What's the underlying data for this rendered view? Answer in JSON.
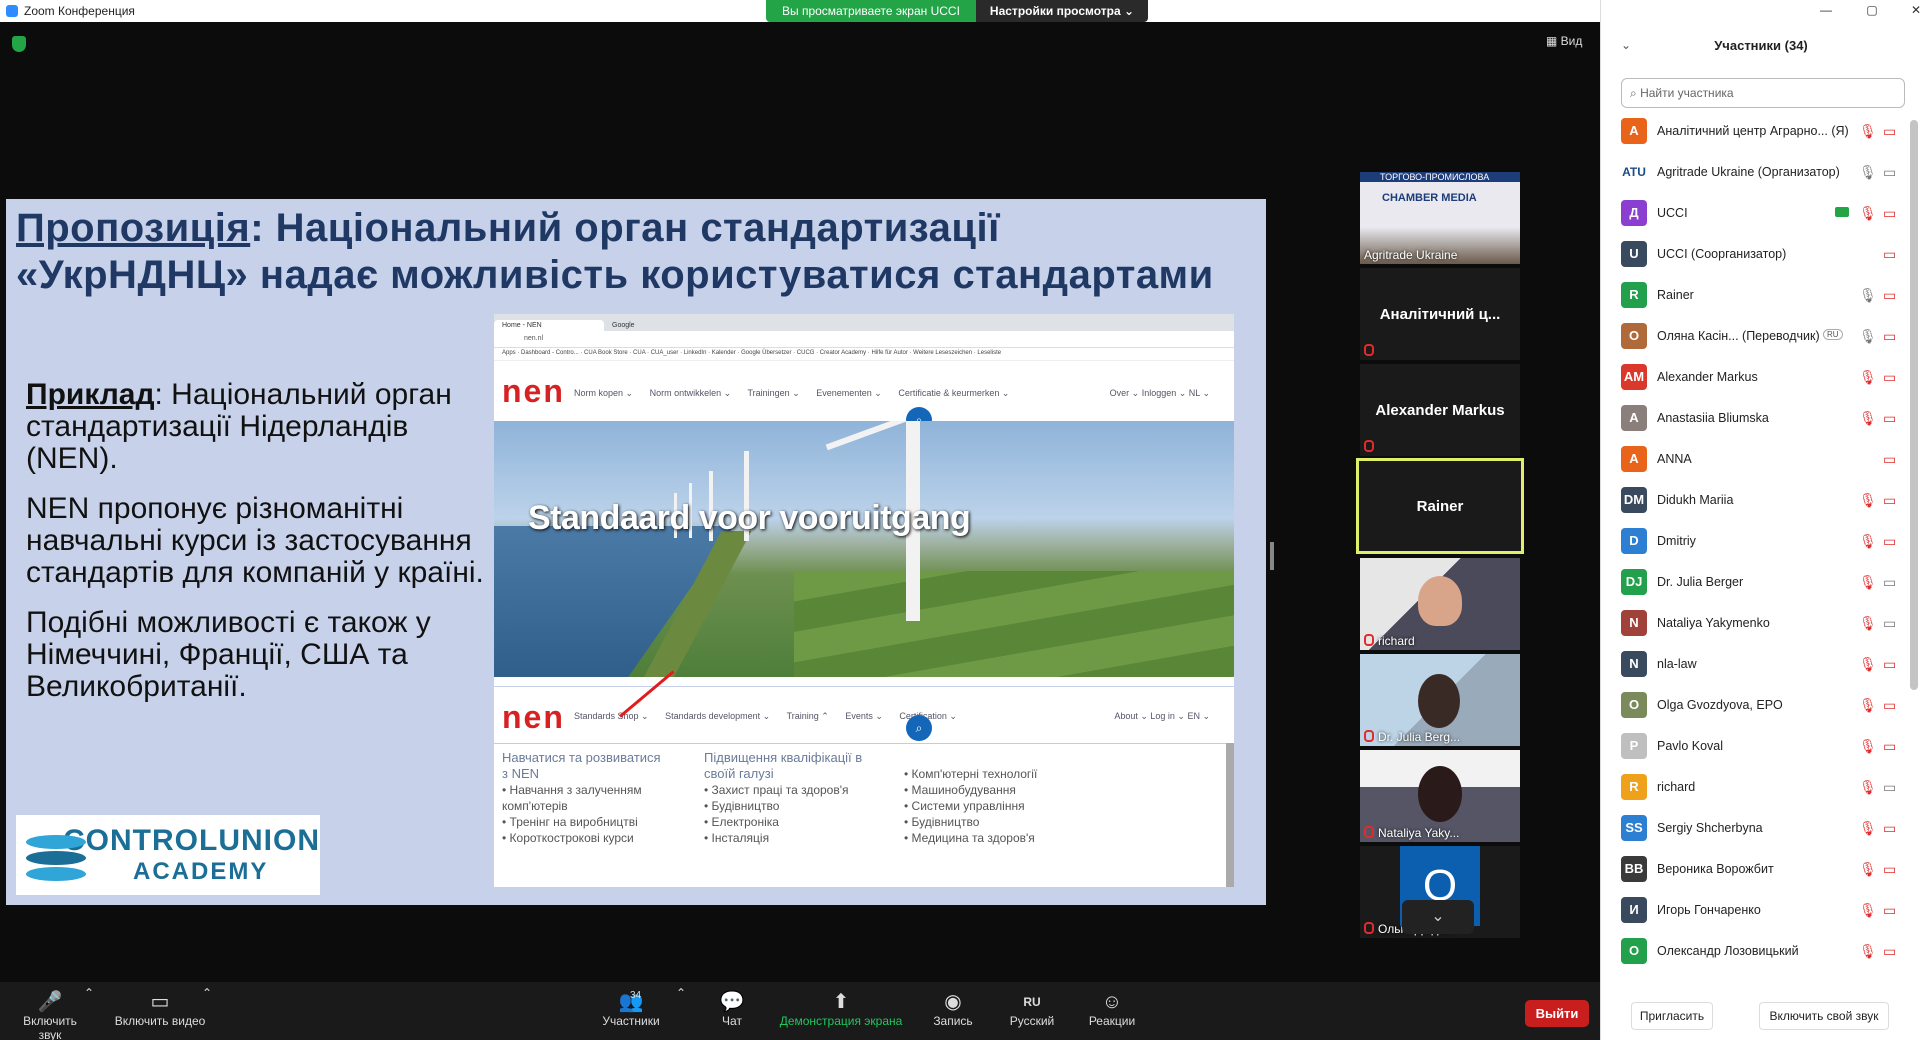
{
  "window": {
    "title": "Zoom Конференция"
  },
  "banner": {
    "viewing": "Вы просматриваете экран UCCI",
    "view_settings": "Настройки просмотра ⌄"
  },
  "view_button": "Вид",
  "slide": {
    "title_underlined": "Пропозиція",
    "title_rest": ":  Національний орган стандартизації «УкрНДНЦ» надає можливість користуватися стандартами",
    "example_label": "Приклад",
    "paragraph1": ": Національний орган стандартизації Нідерландів (NEN).",
    "paragraph2": "NEN пропонує різноманітні навчальні курси із застосування стандартів для компаній у країні.",
    "paragraph3": "Подібні можливості є також у Німеччині, Франції, США та Великобританії.",
    "logo_line1": "CONTROLUNION",
    "logo_line2": "ACADEMY",
    "browser": {
      "tab1": "Home - NEN",
      "tab2": "Google",
      "url": "nen.nl",
      "bookmarks": "Apps · Dashboard - Contro... · CUA Book Store · CUA · CUA_user · LinkedIn · Kalender · Google Übersetzer · CUCG · Creator Academy · Hilfe für Autor · Weitere Leseszeichen · Leseliste",
      "nen_logo": "nen",
      "menu": [
        "Norm kopen ⌄",
        "Norm ontwikkelen ⌄",
        "Trainingen ⌄",
        "Evenementen ⌄",
        "Certificatie & keurmerken ⌄"
      ],
      "menu_right": "Over ⌄   Inloggen ⌄   NL ⌄",
      "hero_text": "Standaard voor vooruitgang",
      "menu2": [
        "Standards Shop ⌄",
        "Standards development ⌄",
        "Training ⌃",
        "Events ⌄",
        "Certification ⌄"
      ],
      "menu2_right": "About ⌄   Log in ⌄   EN ⌄",
      "dropdown": {
        "col1_head": "Навчатися та розвиватися з NEN",
        "col1": [
          "• Навчання з залученням комп'ютерів",
          "• Тренінг на виробництві",
          "• Короткострокові курси"
        ],
        "col2_head": "Підвищення кваліфікації в своїй галузі",
        "col2": [
          "• Захист праці та здоров'я",
          "• Будівництво",
          "• Електроніка",
          "• Інсталяція"
        ],
        "col3": [
          "• Комп'ютерні технології",
          "• Машинобудування",
          "• Системи управління",
          "• Будівництво",
          "• Медицина та здоров'я"
        ]
      }
    }
  },
  "gallery": [
    {
      "name": "Agritrade Ukraine",
      "type": "video",
      "banner": "ТОРГОВО-ПРОМИСЛОВА",
      "banner2": "CHAMBER MEDIA"
    },
    {
      "name": "Аналітичний ц...",
      "type": "name"
    },
    {
      "name": "Alexander Markus",
      "type": "name"
    },
    {
      "name": "Rainer",
      "type": "name",
      "active": true
    },
    {
      "name": "richard",
      "type": "video"
    },
    {
      "name": "Dr. Julia Berg...",
      "type": "video"
    },
    {
      "name": "Nataliya Yaky...",
      "type": "video"
    },
    {
      "name": "Ольга Дюдя...",
      "type": "initial",
      "initial": "O"
    }
  ],
  "toolbar": {
    "unmute": "Включить звук",
    "start_video": "Включить видео",
    "participants": "Участники",
    "participants_count": "34",
    "chat": "Чат",
    "share": "Демонстрация экрана",
    "record": "Запись",
    "language": "Русский",
    "language_badge": "RU",
    "reactions": "Реакции",
    "leave": "Выйти"
  },
  "panel": {
    "title": "Участники (34)",
    "search_placeholder": "Найти участника",
    "invite": "Пригласить",
    "unmute_me": "Включить свой звук",
    "participants": [
      {
        "name": "Аналітичний центр Аграрно... (Я)",
        "initial": "А",
        "color": "#e8641b",
        "mic": "muted",
        "cam": "off"
      },
      {
        "name": "Agritrade Ukraine (Организатор)",
        "initial": "ATU",
        "color": "#ffffff",
        "mic": "on",
        "cam": "on"
      },
      {
        "name": "UCCI",
        "initial": "Д",
        "color": "#8b3fd1",
        "mic": "muted",
        "cam": "off",
        "share": true
      },
      {
        "name": "UCCI (Соорганизатор)",
        "initial": "U",
        "color": "#3a4a5e",
        "mic": "",
        "cam": "off"
      },
      {
        "name": "Rainer",
        "initial": "R",
        "color": "#22a04b",
        "mic": "on",
        "cam": "off"
      },
      {
        "name": "Оляна Касін...  (Переводчик)",
        "initial": "О",
        "color": "#b06a3a",
        "mic": "on",
        "cam": "off",
        "badge": "RU"
      },
      {
        "name": "Alexander Markus",
        "initial": "AM",
        "color": "#d9382b",
        "mic": "muted",
        "cam": "off"
      },
      {
        "name": "Anastasiia Bliumska",
        "initial": "A",
        "color": "#8a7f7a",
        "mic": "muted",
        "cam": "off"
      },
      {
        "name": "ANNA",
        "initial": "A",
        "color": "#e8641b",
        "mic": "",
        "cam": "off"
      },
      {
        "name": "Didukh Mariia",
        "initial": "DM",
        "color": "#3a4a5e",
        "mic": "muted",
        "cam": "off"
      },
      {
        "name": "Dmitriy",
        "initial": "D",
        "color": "#2d7fd1",
        "mic": "muted",
        "cam": "off"
      },
      {
        "name": "Dr. Julia Berger",
        "initial": "DJ",
        "color": "#22a04b",
        "mic": "muted",
        "cam": "on"
      },
      {
        "name": "Nataliya Yakymenko",
        "initial": "N",
        "color": "#a0413a",
        "mic": "muted",
        "cam": "on"
      },
      {
        "name": "nla-law",
        "initial": "N",
        "color": "#3a4a5e",
        "mic": "muted",
        "cam": "off"
      },
      {
        "name": "Olga Gvozdyova, EPO",
        "initial": "O",
        "color": "#7a8a5a",
        "mic": "muted",
        "cam": "off"
      },
      {
        "name": "Pavlo Koval",
        "initial": "P",
        "color": "#bfbfbf",
        "mic": "muted",
        "cam": "off"
      },
      {
        "name": "richard",
        "initial": "R",
        "color": "#f0a11b",
        "mic": "muted",
        "cam": "on"
      },
      {
        "name": "Sergiy Shcherbyna",
        "initial": "SS",
        "color": "#2d7fd1",
        "mic": "muted",
        "cam": "off"
      },
      {
        "name": "Вероника Ворожбит",
        "initial": "ВВ",
        "color": "#3a3a3a",
        "mic": "muted",
        "cam": "off"
      },
      {
        "name": "Игорь Гончаренко",
        "initial": "И",
        "color": "#3a4a5e",
        "mic": "muted",
        "cam": "off"
      },
      {
        "name": "Олександр Лозовицький",
        "initial": "О",
        "color": "#22a04b",
        "mic": "muted",
        "cam": "off"
      }
    ]
  }
}
